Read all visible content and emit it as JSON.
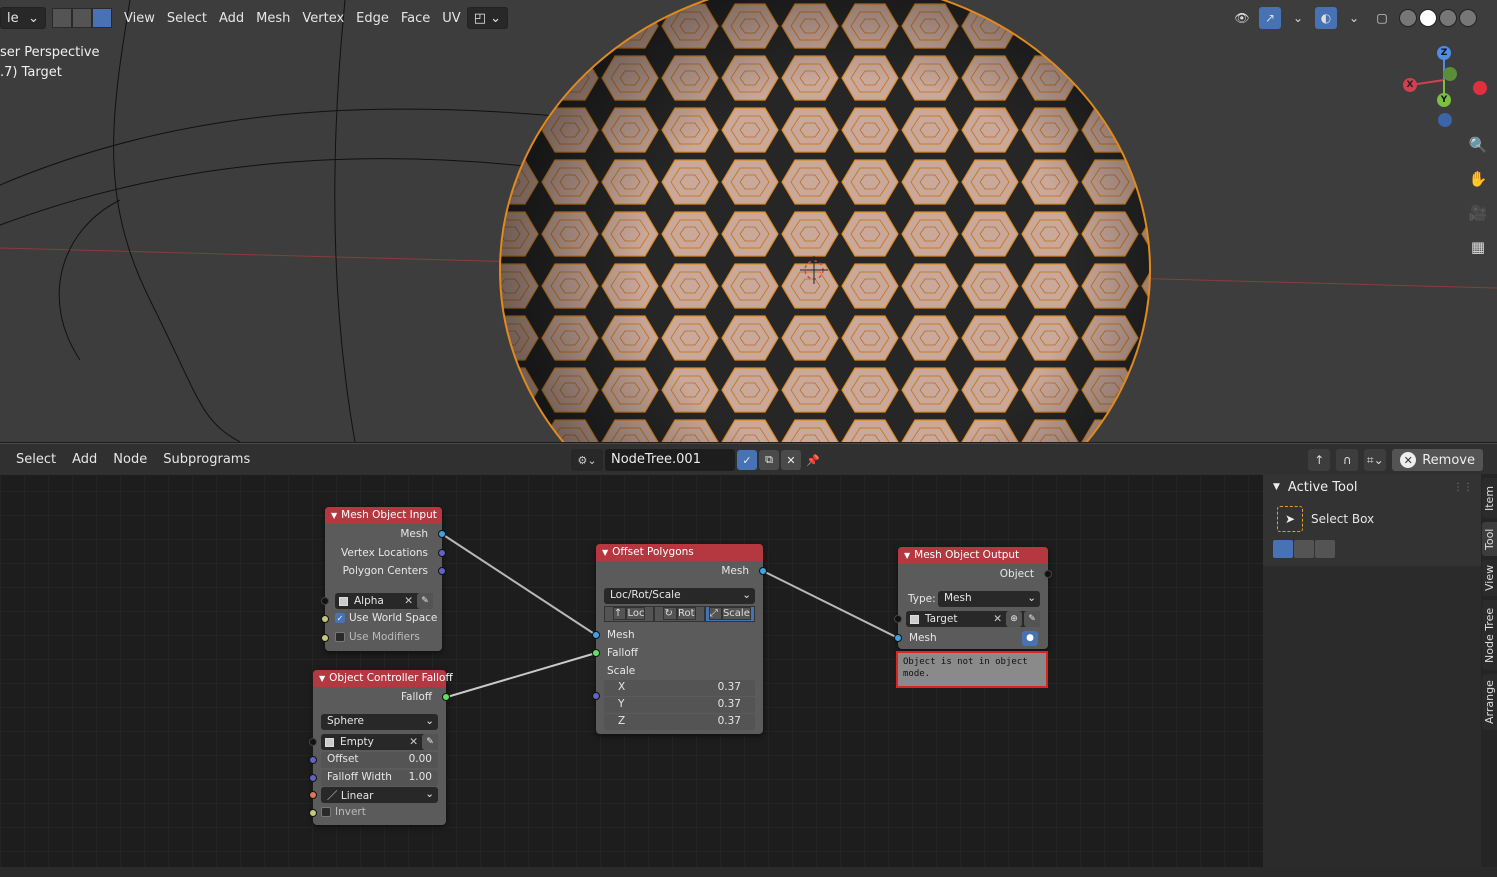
{
  "viewport": {
    "mode_label": "le",
    "menu": [
      "View",
      "Select",
      "Add",
      "Mesh",
      "Vertex",
      "Edge",
      "Face",
      "UV"
    ],
    "overlay_line1": "ser Perspective",
    "overlay_line2": ".7) Target",
    "gizmo": {
      "z": "Z",
      "x": "X",
      "y": "Y"
    }
  },
  "node_editor": {
    "menu": [
      "Select",
      "Add",
      "Node",
      "Subprograms"
    ],
    "tree_name": "NodeTree.001",
    "remove_label": "Remove"
  },
  "nodes": {
    "mesh_input": {
      "title": "Mesh Object Input",
      "out_mesh": "Mesh",
      "out_vertex_locations": "Vertex Locations",
      "out_polygon_centers": "Polygon Centers",
      "object": "Alpha",
      "use_world_space": "Use World Space",
      "use_modifiers": "Use Modifiers"
    },
    "controller_falloff": {
      "title": "Object Controller Falloff",
      "out_falloff": "Falloff",
      "shape": "Sphere",
      "object": "Empty",
      "offset_label": "Offset",
      "offset_value": "0.00",
      "width_label": "Falloff Width",
      "width_value": "1.00",
      "interpolation": "Linear",
      "invert": "Invert"
    },
    "offset_polygons": {
      "title": "Offset Polygons",
      "out_mesh": "Mesh",
      "mode": "Loc/Rot/Scale",
      "seg_loc": "Loc",
      "seg_rot": "Rot",
      "seg_scale": "Scale",
      "in_mesh": "Mesh",
      "in_falloff": "Falloff",
      "scale_label": "Scale",
      "x_label": "X",
      "x_value": "0.37",
      "y_label": "Y",
      "y_value": "0.37",
      "z_label": "Z",
      "z_value": "0.37"
    },
    "mesh_output": {
      "title": "Mesh Object Output",
      "out_object": "Object",
      "type_label": "Type:",
      "type_value": "Mesh",
      "object": "Target",
      "in_mesh": "Mesh",
      "error": "Object is not in object mode."
    }
  },
  "sidebar": {
    "panel_title": "Active Tool",
    "tool_name": "Select Box",
    "tabs": [
      "Item",
      "Tool",
      "View",
      "Node Tree",
      "Arrange"
    ]
  },
  "colors": {
    "node_header": "#b53840",
    "accent": "#4772b3",
    "mesh_socket": "#3ea4e6",
    "falloff_socket": "#5ce55c",
    "wire_orange": "#e08a1e"
  }
}
